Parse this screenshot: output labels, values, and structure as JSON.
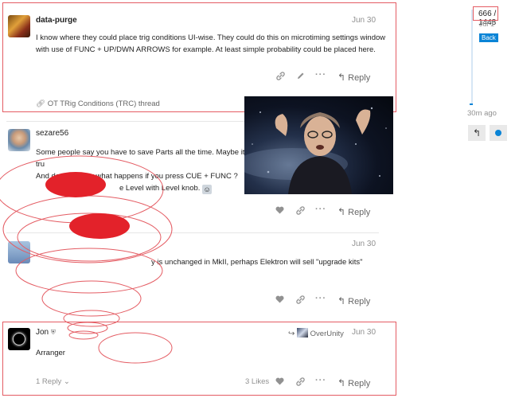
{
  "posts": [
    {
      "username": "data-purge",
      "date": "Jun 30",
      "body": [
        "I know where they could place trig conditions UI-wise. They could do this on microtiming settings window",
        "with use of FUNC + UP/DWN ARROWS for example. At least simple probability could be placed here."
      ],
      "reply_label": "Reply",
      "thread_link": "OT TRig Conditions (TRC) thread"
    },
    {
      "username": "sezare56",
      "body": [
        "Some people say you have to save Parts all the time. Maybe it's tru",
        "And do you know what happens if you press CUE + FUNC ?",
        "e Level with Level knob."
      ],
      "reply_label": "Reply"
    },
    {
      "date": "Jun 30",
      "body": [
        "y is unchanged in MkII, perhaps Elektron will sell \"upgrade kits\""
      ],
      "reply_label": "Reply"
    },
    {
      "username": "Jon",
      "reply_to": "OverUnity",
      "date": "Jun 30",
      "body": [
        "Arranger"
      ],
      "replies_label": "1 Reply",
      "likes_label": "3 Likes",
      "reply_label": "Reply"
    }
  ],
  "timeline": {
    "current": "666",
    "separator": "/",
    "total": "1448",
    "date_label": "Jul 1",
    "back_label": "Back",
    "bottom_label": "30m ago"
  },
  "colors": {
    "annotation_red": "#e45c63",
    "accent_blue": "#0a84d6",
    "muted": "#919191"
  }
}
